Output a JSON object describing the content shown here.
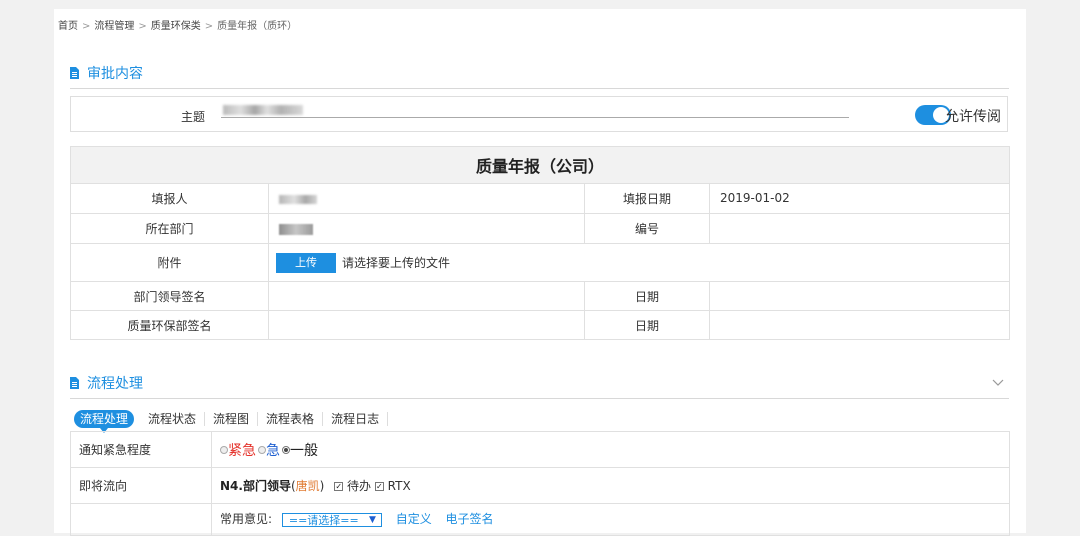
{
  "breadcrumb": {
    "items": [
      "首页",
      "流程管理",
      "质量环保类"
    ],
    "current": "质量年报（质环）",
    "separator": ">"
  },
  "approval": {
    "section_title": "审批内容",
    "subject_label": "主题",
    "allow_circulate_label": "允许传阅",
    "allow_circulate_on": true
  },
  "form": {
    "title": "质量年报（公司）",
    "reporter_label": "填报人",
    "report_date_label": "填报日期",
    "report_date_value": "2019-01-02",
    "dept_label": "所在部门",
    "number_label": "编号",
    "attachment_label": "附件",
    "upload_label": "上传",
    "upload_hint": "请选择要上传的文件",
    "dept_leader_sign_label": "部门领导签名",
    "qe_dept_sign_label": "质量环保部签名",
    "date_label": "日期"
  },
  "process": {
    "section_title": "流程处理",
    "tabs": [
      "流程处理",
      "流程状态",
      "流程图",
      "流程表格",
      "流程日志"
    ],
    "urgency_label": "通知紧急程度",
    "urgency_options": [
      "紧急",
      "急",
      "一般"
    ],
    "urgency_selected": "一般",
    "next_flow_label": "即将流向",
    "next_node": "N4.部门领导",
    "next_person_open": "(",
    "next_person": "唐凯",
    "next_person_close": ")",
    "todo_label": "待办",
    "rtx_label": "RTX",
    "common_opinion_label": "常用意见:",
    "select_placeholder": "==请选择==",
    "custom_label": "自定义",
    "esign_label": "电子签名"
  },
  "colors": {
    "accent": "#1e8fe0",
    "urgent": "#e4312a",
    "high": "#1e5fd0",
    "person": "#e07b32"
  }
}
